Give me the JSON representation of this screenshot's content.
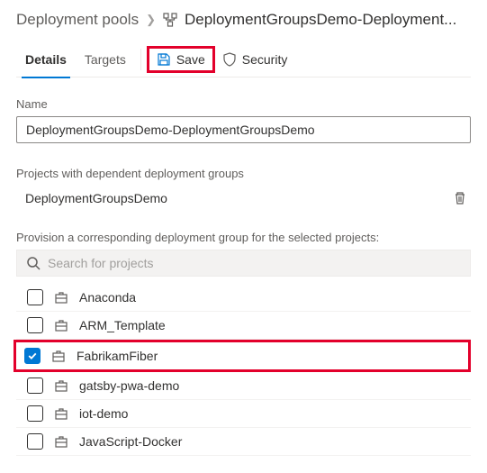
{
  "breadcrumb": {
    "root": "Deployment pools",
    "current": "DeploymentGroupsDemo-Deployment..."
  },
  "tabs": {
    "details": "Details",
    "targets": "Targets"
  },
  "toolbar": {
    "save_label": "Save",
    "security_label": "Security"
  },
  "name_section": {
    "label": "Name",
    "value": "DeploymentGroupsDemo-DeploymentGroupsDemo"
  },
  "dependent_section": {
    "label": "Projects with dependent deployment groups",
    "items": [
      "DeploymentGroupsDemo"
    ]
  },
  "provision_section": {
    "label": "Provision a corresponding deployment group for the selected projects:",
    "search_placeholder": "Search for projects",
    "projects": [
      {
        "name": "Anaconda",
        "checked": false
      },
      {
        "name": "ARM_Template",
        "checked": false
      },
      {
        "name": "FabrikamFiber",
        "checked": true,
        "highlight": true
      },
      {
        "name": "gatsby-pwa-demo",
        "checked": false
      },
      {
        "name": "iot-demo",
        "checked": false
      },
      {
        "name": "JavaScript-Docker",
        "checked": false
      }
    ]
  }
}
